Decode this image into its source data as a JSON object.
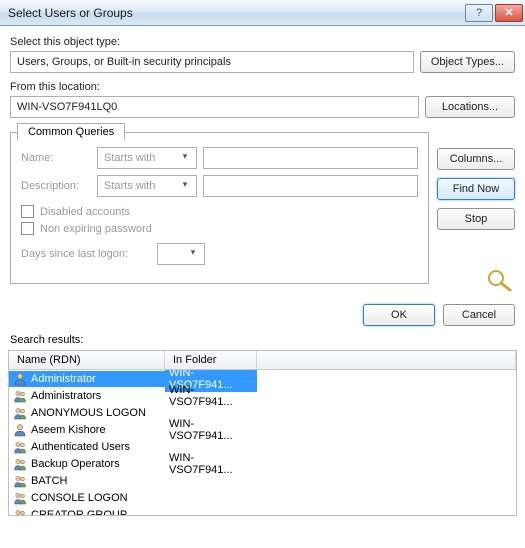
{
  "window": {
    "title": "Select Users or Groups",
    "help_icon": "?",
    "close_icon": "✕"
  },
  "objectType": {
    "label": "Select this object type:",
    "value": "Users, Groups, or Built-in security principals",
    "button": "Object Types..."
  },
  "location": {
    "label": "From this location:",
    "value": "WIN-VSO7F941LQ0",
    "button": "Locations..."
  },
  "queries": {
    "tab": "Common Queries",
    "nameLabel": "Name:",
    "nameMode": "Starts with",
    "nameValue": "",
    "descLabel": "Description:",
    "descMode": "Starts with",
    "descValue": "",
    "disabled": "Disabled accounts",
    "nonexp": "Non expiring password",
    "daysLabel": "Days since last logon:",
    "daysValue": ""
  },
  "sideButtons": {
    "columns": "Columns...",
    "findNow": "Find Now",
    "stop": "Stop"
  },
  "actions": {
    "ok": "OK",
    "cancel": "Cancel"
  },
  "results": {
    "label": "Search results:",
    "headers": {
      "name": "Name (RDN)",
      "folder": "In Folder"
    },
    "rows": [
      {
        "name": "Administrator",
        "folder": "WIN-VSO7F941...",
        "icon": "user",
        "selected": true
      },
      {
        "name": "Administrators",
        "folder": "WIN-VSO7F941...",
        "icon": "group"
      },
      {
        "name": "ANONYMOUS LOGON",
        "folder": "",
        "icon": "group"
      },
      {
        "name": "Aseem Kishore",
        "folder": "WIN-VSO7F941...",
        "icon": "user"
      },
      {
        "name": "Authenticated Users",
        "folder": "",
        "icon": "group"
      },
      {
        "name": "Backup Operators",
        "folder": "WIN-VSO7F941...",
        "icon": "group"
      },
      {
        "name": "BATCH",
        "folder": "",
        "icon": "group"
      },
      {
        "name": "CONSOLE LOGON",
        "folder": "",
        "icon": "group"
      },
      {
        "name": "CREATOR GROUP",
        "folder": "",
        "icon": "group"
      }
    ]
  }
}
